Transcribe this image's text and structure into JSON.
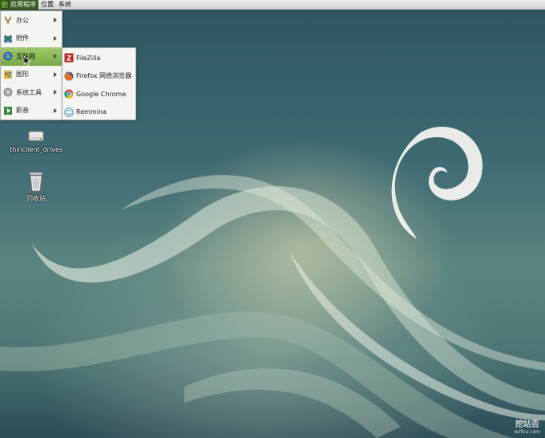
{
  "top_panel": {
    "menus": [
      {
        "label": "应用程序"
      },
      {
        "label": "位置"
      },
      {
        "label": "系统"
      }
    ]
  },
  "main_menu": {
    "items": [
      {
        "label": "办公",
        "icon": "office-icon"
      },
      {
        "label": "附件",
        "icon": "accessories-icon"
      },
      {
        "label": "互联网",
        "icon": "internet-globe-icon"
      },
      {
        "label": "图形",
        "icon": "graphics-icon"
      },
      {
        "label": "系统工具",
        "icon": "system-tools-icon"
      },
      {
        "label": "影音",
        "icon": "multimedia-icon"
      }
    ]
  },
  "internet_submenu": {
    "items": [
      {
        "label": "FileZilla",
        "icon": "filezilla-icon"
      },
      {
        "label": "Firefox 网络浏览器",
        "icon": "firefox-icon"
      },
      {
        "label": "Google Chrome",
        "icon": "chrome-icon"
      },
      {
        "label": "Remmina",
        "icon": "remmina-icon"
      }
    ]
  },
  "desktop": {
    "icons": [
      {
        "label": "thinclient_drives",
        "icon": "drive-icon"
      },
      {
        "label": "回收站",
        "icon": "trash-icon"
      }
    ],
    "watermark": {
      "main": "挖站否",
      "sub": "wzfou.com"
    }
  },
  "colors": {
    "menu_highlight": "#8bb75a",
    "panel_active": "#3a5a1e",
    "menu_bg": "#f4f4f1"
  }
}
